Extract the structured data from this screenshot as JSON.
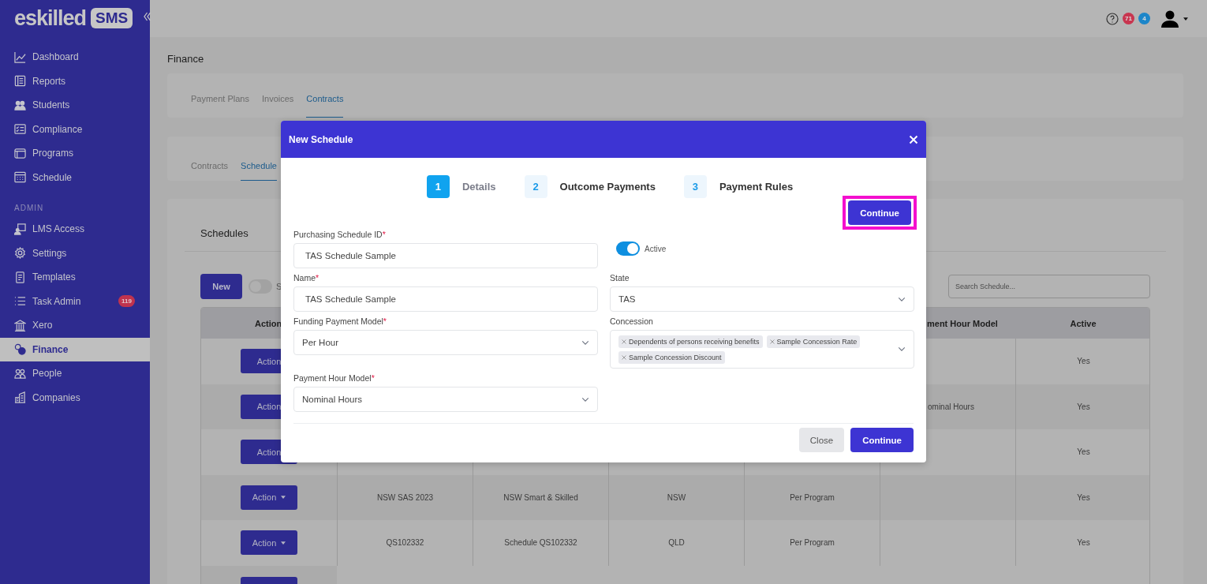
{
  "sidebar": {
    "logo": {
      "word": "eskilled",
      "badge": "SMS"
    },
    "sections": [
      {
        "items": [
          {
            "label": "Dashboard",
            "selected": false
          },
          {
            "label": "Reports",
            "selected": false
          },
          {
            "label": "Students",
            "selected": false
          },
          {
            "label": "Compliance",
            "selected": false
          },
          {
            "label": "Programs",
            "selected": false
          },
          {
            "label": "Schedule",
            "selected": false
          }
        ]
      },
      {
        "heading": "ADMIN",
        "items": [
          {
            "label": "LMS Access",
            "selected": false
          },
          {
            "label": "Settings",
            "selected": false
          },
          {
            "label": "Templates",
            "selected": false
          },
          {
            "label": "Task Admin",
            "selected": false,
            "badge": "119"
          },
          {
            "label": "Xero",
            "selected": false
          },
          {
            "label": "Finance",
            "selected": true
          },
          {
            "label": "People",
            "selected": false
          },
          {
            "label": "Companies",
            "selected": false
          }
        ]
      }
    ]
  },
  "top_bar": {
    "badges": [
      {
        "count": "71",
        "color": "#c8354f"
      },
      {
        "count": "4",
        "color": "#1d86c9"
      }
    ]
  },
  "page_title": "Finance",
  "main_tabs": [
    {
      "label": "Payment Plans",
      "selected": false
    },
    {
      "label": "Invoices",
      "selected": false
    },
    {
      "label": "Contracts",
      "selected": true
    }
  ],
  "sub_tabs": [
    {
      "label": "Contracts",
      "selected": false
    },
    {
      "label": "Schedule",
      "selected": true
    }
  ],
  "schedules": {
    "title": "Schedules",
    "new_button": "New",
    "toggle": {
      "on": false,
      "label": "S"
    },
    "search": {
      "placeholder": "Search Schedule..."
    },
    "columns": [
      "Action",
      "",
      "",
      "",
      "",
      "ment Hour Model",
      "Active"
    ],
    "rows": [
      {
        "caret": false,
        "cells": [
          "Action",
          "",
          "",
          "",
          "",
          "",
          "Yes"
        ]
      },
      {
        "caret": false,
        "cells": [
          "Action",
          "",
          "",
          "",
          "",
          "ominal Hours",
          "Yes"
        ]
      },
      {
        "caret": false,
        "cells": [
          "Action",
          "",
          "",
          "",
          "",
          "",
          "Yes"
        ]
      },
      {
        "caret": true,
        "cells": [
          "Action",
          "NSW SAS 2023",
          "NSW Smart & Skilled",
          "NSW",
          "Per Program",
          "",
          "Yes"
        ]
      },
      {
        "caret": true,
        "cells": [
          "Action",
          "QS102332",
          "Schedule QS102332",
          "QLD",
          "Per Program",
          "",
          "Yes"
        ]
      }
    ]
  },
  "dialog": {
    "title": "New Schedule",
    "steps": [
      {
        "number": "1",
        "label": "Details",
        "selected": true
      },
      {
        "number": "2",
        "label": "Outcome Payments",
        "selected": false
      },
      {
        "number": "3",
        "label": "Payment Rules",
        "selected": false
      }
    ],
    "top_button": {
      "label": "Continue",
      "highlighted": true
    },
    "form_rows": [
      [
        {
          "kind": "text",
          "label": "Purchasing Schedule ID",
          "mark": "*",
          "value": "TAS Schedule Sample"
        },
        {
          "kind": "toggle",
          "label": "Active",
          "on": true
        }
      ],
      [
        {
          "kind": "text",
          "label": "Name",
          "mark": "*",
          "value": "TAS Schedule Sample"
        },
        {
          "kind": "select",
          "label": "State",
          "value": "TAS"
        }
      ],
      [
        {
          "kind": "select",
          "label": "Funding Payment Model",
          "mark": "*",
          "value": "Per Hour"
        },
        {
          "kind": "multiselect",
          "label": "Concession",
          "tags": [
            "Dependents of persons receiving benefits",
            "Sample Concession Rate",
            "Sample Concession Discount"
          ]
        }
      ],
      [
        {
          "kind": "select",
          "label": "Payment Hour Model",
          "mark": "*",
          "value": "Nominal Hours"
        }
      ]
    ],
    "buttons": [
      {
        "label": "Close",
        "kind": "secondary"
      },
      {
        "label": "Continue",
        "kind": "primary"
      }
    ]
  }
}
